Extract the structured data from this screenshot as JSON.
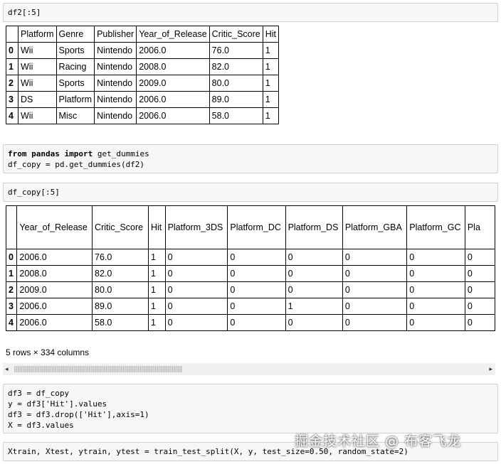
{
  "cells": {
    "c1": {
      "lines": [
        "df2[:5]"
      ]
    },
    "c2": {
      "lines": [
        "get_dummies",
        "df_copy = pd.get_dummies(df2)"
      ],
      "kw_from": "from",
      "mod": "pandas",
      "kw_import": "import"
    },
    "c3": {
      "lines": [
        "df_copy[:5]"
      ]
    },
    "c4": {
      "lines": [
        "df3 = df_copy",
        "y = df3['Hit'].values",
        "df3 = df3.drop(['Hit'],axis=1)",
        "X = df3.values"
      ]
    },
    "c5": {
      "lines": [
        "Xtrain, Xtest, ytrain, ytest = train_test_split(X, y, test_size=0.50, random_state=2)"
      ]
    }
  },
  "table1": {
    "columns": [
      "",
      "Platform",
      "Genre",
      "Publisher",
      "Year_of_Release",
      "Critic_Score",
      "Hit"
    ],
    "rows": [
      [
        "0",
        "Wii",
        "Sports",
        "Nintendo",
        "2006.0",
        "76.0",
        "1"
      ],
      [
        "1",
        "Wii",
        "Racing",
        "Nintendo",
        "2008.0",
        "82.0",
        "1"
      ],
      [
        "2",
        "Wii",
        "Sports",
        "Nintendo",
        "2009.0",
        "80.0",
        "1"
      ],
      [
        "3",
        "DS",
        "Platform",
        "Nintendo",
        "2006.0",
        "89.0",
        "1"
      ],
      [
        "4",
        "Wii",
        "Misc",
        "Nintendo",
        "2006.0",
        "58.0",
        "1"
      ]
    ]
  },
  "table2": {
    "columns": [
      "",
      "Year_of_Release",
      "Critic_Score",
      "Hit",
      "Platform_3DS",
      "Platform_DC",
      "Platform_DS",
      "Platform_GBA",
      "Platform_GC",
      "Pla"
    ],
    "rows": [
      [
        "0",
        "2006.0",
        "76.0",
        "1",
        "0",
        "0",
        "0",
        "0",
        "0",
        "0"
      ],
      [
        "1",
        "2008.0",
        "82.0",
        "1",
        "0",
        "0",
        "0",
        "0",
        "0",
        "0"
      ],
      [
        "2",
        "2009.0",
        "80.0",
        "1",
        "0",
        "0",
        "0",
        "0",
        "0",
        "0"
      ],
      [
        "3",
        "2006.0",
        "89.0",
        "1",
        "0",
        "0",
        "1",
        "0",
        "0",
        "0"
      ],
      [
        "4",
        "2006.0",
        "58.0",
        "1",
        "0",
        "0",
        "0",
        "0",
        "0",
        "0"
      ]
    ],
    "shape_note": "5 rows × 334 columns"
  },
  "scrollbar": {
    "left_arrow": "◂",
    "right_arrow": "▸"
  },
  "watermark": "掘金技术社区 @ 布客飞龙"
}
